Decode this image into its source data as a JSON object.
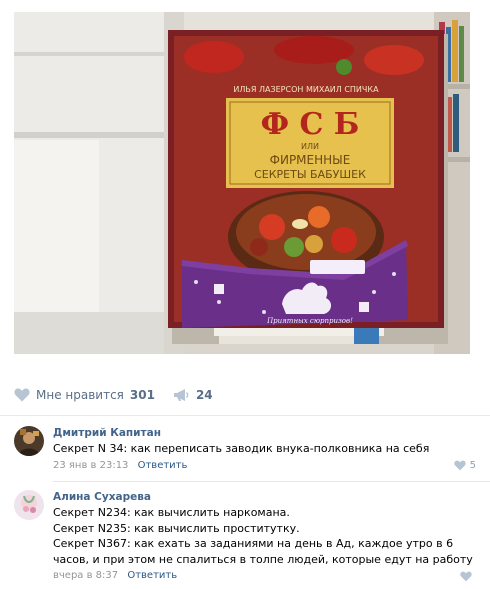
{
  "post": {
    "photo": {
      "description_icon": "photo",
      "book_authors": "ИЛЬЯ ЛАЗЕРСОН      МИХАИЛ СПИЧКА",
      "book_title_big": "Ф С Б",
      "book_title_or": "ИЛИ",
      "book_title_line2": "ФИРМЕННЫЕ",
      "book_title_line3": "СЕКРЕТЫ БАБУШЕК",
      "sleeve_text": "Приятных сюрпризов!"
    },
    "likes": {
      "label": "Мне нравится",
      "count": "301",
      "icon": "heart-icon"
    },
    "reposts": {
      "count": "24",
      "icon": "megaphone-icon"
    }
  },
  "comments": [
    {
      "author": "Дмитрий Капитан",
      "lines": [
        "Секрет N 34: как переписать заводик внука-полковника на себя"
      ],
      "date": "23 янв в 23:13",
      "reply": "Ответить",
      "likes": "5"
    },
    {
      "author": "Алина Сухарева",
      "lines": [
        "Секрет N234: как вычислить наркомана.",
        "Секрет N235: как вычислить проститутку.",
        "Секрет N367: как ехать за заданиями на день в Ад, каждое утро в 6",
        "часов, и при этом не спалиться в толпе людей, которые едут на работу"
      ],
      "date": "вчера в 8:37",
      "reply": "Ответить",
      "likes": ""
    }
  ],
  "colors": {
    "link": "#2a5885",
    "author": "#42648b",
    "meta": "#939699",
    "action": "#5a6e87"
  }
}
